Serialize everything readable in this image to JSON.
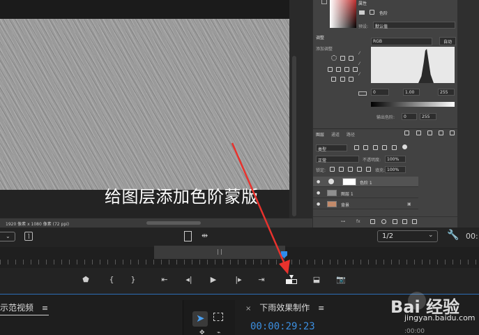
{
  "photoshop": {
    "status_text": "1920 像素 x 1080 像素 (72 ppi)",
    "properties": {
      "tab": "属性",
      "adjustment_label": "色阶",
      "preset_label": "预设:",
      "preset_value": "默认值",
      "channel_value": "RGB",
      "auto_button": "自动",
      "input_black": "0",
      "input_gamma": "1.00",
      "input_white": "255",
      "output_label": "输出色阶:",
      "output_black": "0",
      "output_white": "255"
    },
    "adjustments": {
      "title": "调整",
      "subtitle": "添加调整"
    },
    "layers": {
      "tabs": [
        "图层",
        "通道",
        "路径"
      ],
      "filter_kind": "类型",
      "blend_mode": "正常",
      "opacity_label": "不透明度:",
      "opacity_value": "100%",
      "lock_label": "锁定:",
      "fill_label": "填充:",
      "fill_value": "100%",
      "rows": [
        {
          "name": "色阶 1"
        },
        {
          "name": "图层 1"
        },
        {
          "name": "背景"
        }
      ]
    }
  },
  "caption": "给图层添加色阶蒙版",
  "premiere": {
    "zoom_select": "1/2",
    "timecode_partial": "00:",
    "project_tab": "示范视频",
    "sequence_tab": "下雨效果制作",
    "sequence_close": "×",
    "timecode": "00:00:29:23",
    "mini_timecode": ":00:00",
    "menu_glyph": "≡"
  },
  "watermark": {
    "brand": "Bai 经验",
    "url": "jingyan.baidu.com"
  },
  "colors": {
    "accent_blue": "#2d8ceb",
    "arrow_red": "#e8322d"
  }
}
